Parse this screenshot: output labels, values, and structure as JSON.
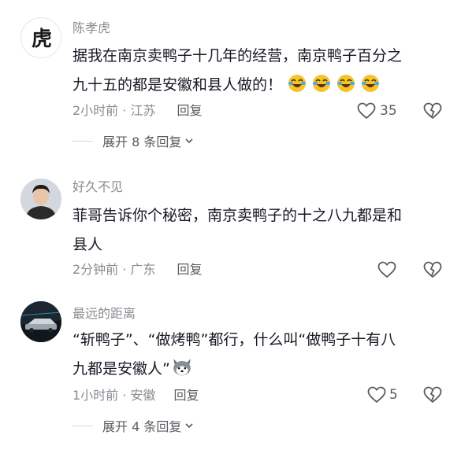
{
  "comments": [
    {
      "username": "陈孝虎",
      "avatar_glyph": "虎",
      "text_line1": "据我在南京卖鸭子十几年的经营，南京鸭子百分之",
      "text_line2": "九十五的都是安徽和县人做的！",
      "emoji": "laughing-crying-emoji",
      "emoji_count": 4,
      "time_location": "2小时前 · 江苏",
      "reply_label": "回复",
      "likes": "35",
      "expand_label": "展开 8 条回复"
    },
    {
      "username": "好久不见",
      "text_line1": "菲哥告诉你个秘密，南京卖鸭子的十之八九都是和",
      "text_line2": "县人",
      "time_location": "2分钟前 · 广东",
      "reply_label": "回复",
      "likes": ""
    },
    {
      "username": "最远的距离",
      "text_line1": "“斩鸭子”、“做烤鸭”都行，什么叫“做鸭子十有八",
      "text_line2": "九都是安徽人”",
      "emoji": "husky-emoji",
      "time_location": "1小时前 · 安徽",
      "reply_label": "回复",
      "likes": "5",
      "expand_label": "展开 4 条回复"
    }
  ],
  "colors": {
    "text": "#161823",
    "secondary": "#8a8b91",
    "icon": "#5a5b61"
  }
}
